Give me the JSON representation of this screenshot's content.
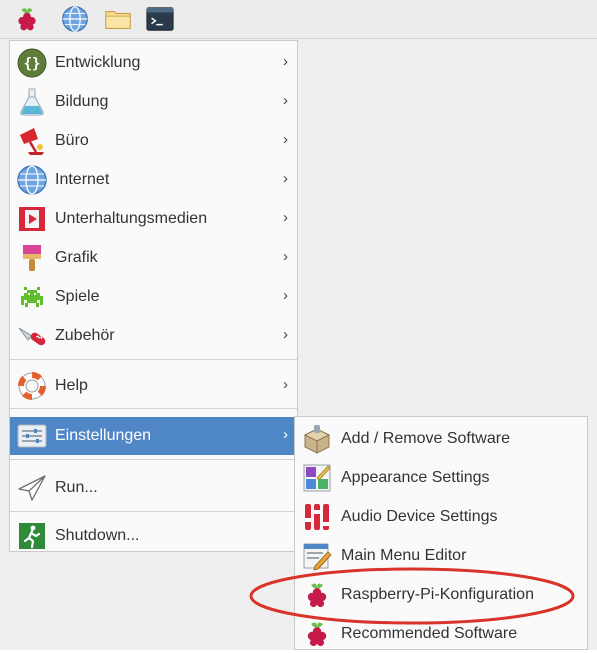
{
  "taskbar": {
    "buttons": [
      {
        "icon": "raspberry-icon"
      },
      {
        "icon": "globe-icon"
      },
      {
        "icon": "folder-icon"
      },
      {
        "icon": "terminal-icon"
      }
    ]
  },
  "main_menu": {
    "items": [
      {
        "label": "Entwicklung",
        "icon": "code-icon",
        "has_submenu": true
      },
      {
        "label": "Bildung",
        "icon": "flask-icon",
        "has_submenu": true
      },
      {
        "label": "Büro",
        "icon": "office-icon",
        "has_submenu": true
      },
      {
        "label": "Internet",
        "icon": "globe-icon",
        "has_submenu": true
      },
      {
        "label": "Unterhaltungsmedien",
        "icon": "media-icon",
        "has_submenu": true
      },
      {
        "label": "Grafik",
        "icon": "paintbrush-icon",
        "has_submenu": true
      },
      {
        "label": "Spiele",
        "icon": "game-icon",
        "has_submenu": true
      },
      {
        "label": "Zubehör",
        "icon": "knife-icon",
        "has_submenu": true
      },
      {
        "label": "Help",
        "icon": "lifebuoy-icon",
        "has_submenu": true
      },
      {
        "label": "Einstellungen",
        "icon": "settings-icon",
        "has_submenu": true,
        "active": true
      },
      {
        "label": "Run...",
        "icon": "paper-plane-icon"
      },
      {
        "label": "Shutdown...",
        "icon": "exit-icon"
      }
    ],
    "arrow": "›"
  },
  "submenu": {
    "items": [
      {
        "label": "Add / Remove Software",
        "icon": "package-icon"
      },
      {
        "label": "Appearance Settings",
        "icon": "appearance-icon"
      },
      {
        "label": "Audio Device Settings",
        "icon": "mixer-icon"
      },
      {
        "label": "Main Menu Editor",
        "icon": "menu-editor-icon"
      },
      {
        "label": "Raspberry-Pi-Konfiguration",
        "icon": "raspberry-icon",
        "highlighted": true
      },
      {
        "label": "Recommended Software",
        "icon": "raspberry-icon"
      }
    ]
  },
  "colors": {
    "active_item": "#4f86c6",
    "annotation_ellipse": "#d9342b",
    "raspberry": "#c51a4a",
    "leaf": "#6cc04a"
  }
}
